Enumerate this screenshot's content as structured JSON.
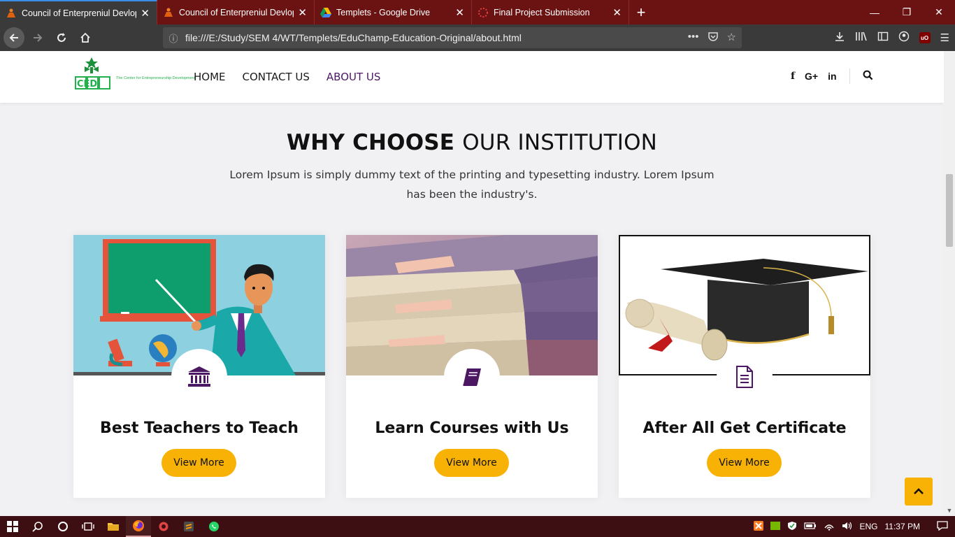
{
  "browser": {
    "tabs": [
      {
        "title": "Council of Enterpreniul Devlopment",
        "active": true
      },
      {
        "title": "Council of Enterpreniul Devlopment",
        "active": false
      },
      {
        "title": "Templets - Google Drive",
        "active": false
      },
      {
        "title": "Final Project Submission",
        "active": false
      }
    ],
    "url": "file:///E:/Study/SEM 4/WT/Templets/EduChamp-Education-Original/about.html"
  },
  "site": {
    "logo_letters": "CED",
    "logo_tagline": "The Center for Entrepreneurship Development",
    "menu": {
      "home": "HOME",
      "contact": "CONTACT US",
      "about": "ABOUT US"
    },
    "social": {
      "facebook": "f",
      "googleplus": "G+",
      "linkedin": "in"
    }
  },
  "section": {
    "title_bold": "WHY CHOOSE",
    "title_light": "OUR INSTITUTION",
    "description": "Lorem Ipsum is simply dummy text of the printing and typesetting industry. Lorem Ipsum has been the industry's."
  },
  "cards": [
    {
      "title": "Best Teachers to Teach",
      "button": "View More",
      "icon": "institution-icon"
    },
    {
      "title": "Learn Courses with Us",
      "button": "View More",
      "icon": "book-icon"
    },
    {
      "title": "After All Get Certificate",
      "button": "View More",
      "icon": "document-icon"
    }
  ],
  "taskbar": {
    "language": "ENG",
    "time": "11:37 PM"
  },
  "colors": {
    "accent": "#f7b205",
    "brand_purple": "#4c1864",
    "tab_bar": "#6b1212",
    "taskbar": "#3e0f12"
  }
}
